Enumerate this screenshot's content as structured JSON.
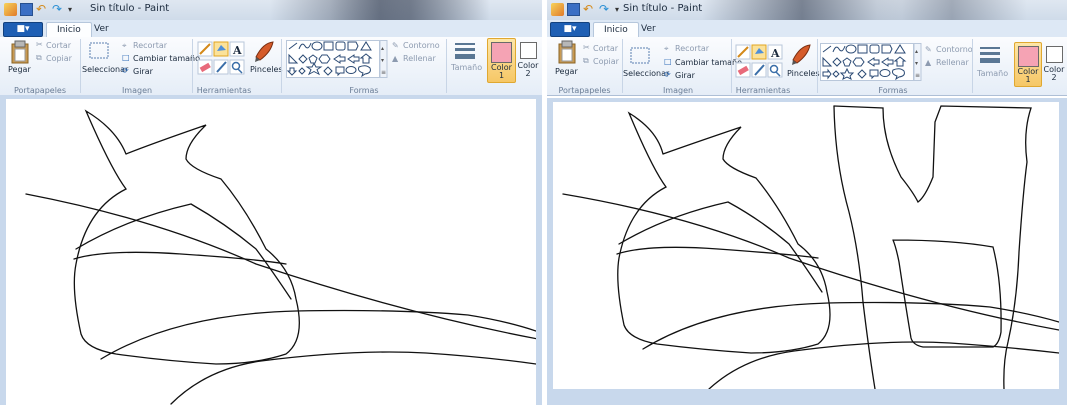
{
  "windows": [
    {
      "title": "Sin título - Paint",
      "tabs": [
        "Inicio",
        "Ver"
      ],
      "groups": {
        "portapapeles": {
          "label": "Portapapeles",
          "paste": "Pegar",
          "cut": "Cortar",
          "copy": "Copiar"
        },
        "imagen": {
          "label": "Imagen",
          "select": "Seleccionar",
          "crop": "Recortar",
          "resize": "Cambiar tamaño",
          "rotate": "Girar"
        },
        "herramientas": {
          "label": "Herramientas",
          "brushes": "Pinceles"
        },
        "formas": {
          "label": "Formas",
          "outline": "Contorno",
          "fill": "Rellenar"
        },
        "size": "Tamaño",
        "color1": "Color 1",
        "color2": "Color 2"
      }
    },
    {
      "title": "Sin título - Paint",
      "tabs": [
        "Inicio",
        "Ver"
      ],
      "groups": {
        "portapapeles": {
          "label": "Portapapeles",
          "paste": "Pegar",
          "cut": "Cortar",
          "copy": "Copiar"
        },
        "imagen": {
          "label": "Imagen",
          "select": "Seleccionar",
          "crop": "Recortar",
          "resize": "Cambiar tamaño",
          "rotate": "Girar"
        },
        "herramientas": {
          "label": "Herramientas",
          "brushes": "Pinceles"
        },
        "formas": {
          "label": "Formas",
          "outline": "Contorno",
          "fill": "Rellenar"
        },
        "size": "Tamaño",
        "color1": "Color 1",
        "color2": "Color 2"
      }
    }
  ],
  "colors": {
    "color1": "#f5a3b4",
    "color2": "#ffffff",
    "file_button": "#1e5fb4",
    "canvas_bg": "#c8d8ec"
  },
  "icons": [
    "paste-icon",
    "cut-icon",
    "copy-icon",
    "select-icon",
    "crop-icon",
    "resize-icon",
    "rotate-icon",
    "pencil-icon",
    "fill-icon",
    "text-icon",
    "eraser-icon",
    "picker-icon",
    "magnifier-icon",
    "brush-icon",
    "shapes-gallery",
    "size-icon"
  ]
}
